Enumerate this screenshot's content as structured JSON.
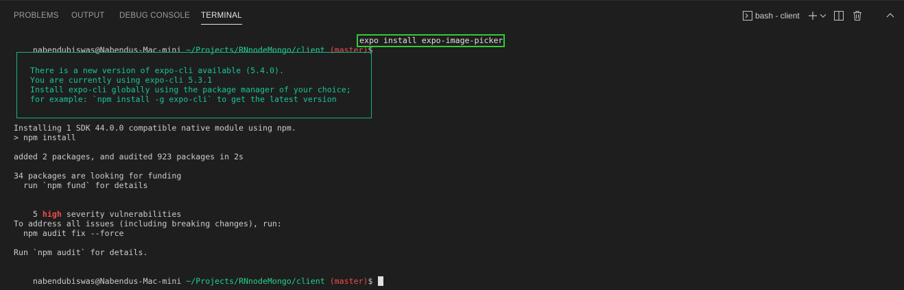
{
  "panel": {
    "tabs": [
      {
        "label": "PROBLEMS"
      },
      {
        "label": "OUTPUT"
      },
      {
        "label": "DEBUG CONSOLE"
      },
      {
        "label": "TERMINAL",
        "active": true
      }
    ],
    "terminal_selector": "bash - client",
    "icons": [
      "terminal-icon",
      "plus-icon",
      "chevron-down-icon",
      "split-icon",
      "trash-icon",
      "chevron-up-icon"
    ]
  },
  "terminal": {
    "prompt_user": "nabendubiswas@Nabendus-Mac-mini",
    "prompt_path": " ~/Projects/RNnodeMongo/client",
    "prompt_branch": " (master)",
    "prompt_symbol": "$ ",
    "command": "expo install expo-image-picker",
    "notice_lines": [
      "There is a new version of expo-cli available (5.4.0).",
      "You are currently using expo-cli 5.3.1",
      "Install expo-cli globally using the package manager of your choice;",
      "for example: `npm install -g expo-cli` to get the latest version"
    ],
    "output": {
      "installing": "Installing 1 SDK 44.0.0 compatible native module using npm.",
      "npm_install": "> npm install",
      "added": "added 2 packages, and audited 923 packages in 2s",
      "funding": "34 packages are looking for funding",
      "funding_detail": "  run `npm fund` for details",
      "vuln_count": "5 ",
      "vuln_severity": "high",
      "vuln_suffix": " severity vulnerabilities",
      "address": "To address all issues (including breaking changes), run:",
      "audit_fix": "  npm audit fix --force",
      "run_audit": "Run `npm audit` for details."
    }
  },
  "colors": {
    "background": "#1e1e1e",
    "prompt_path": "#23d18b",
    "prompt_branch": "#f14c4c",
    "highlight_box": "#33cc33",
    "notice": "#19c49a"
  }
}
